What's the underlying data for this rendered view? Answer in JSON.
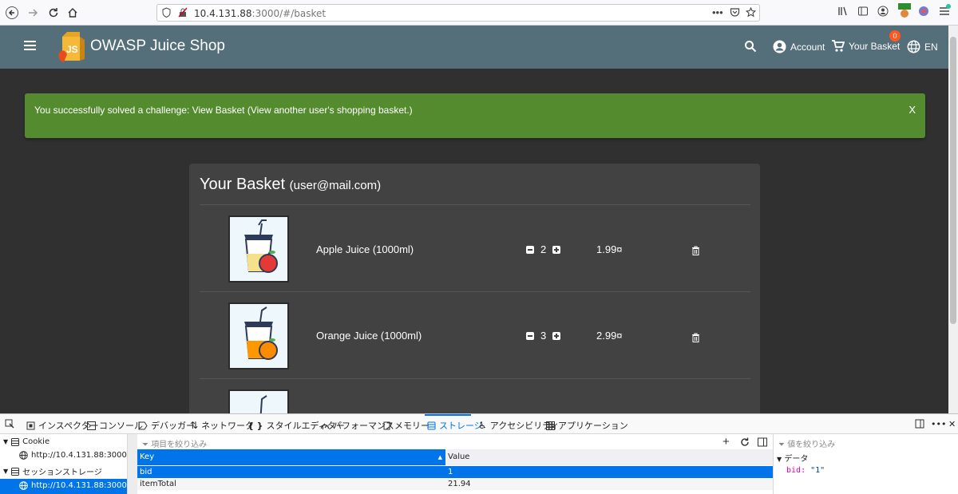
{
  "browser": {
    "url_host": "10.4.131.88",
    "url_path": ":3000/#/basket"
  },
  "app": {
    "title": "OWASP Juice Shop",
    "account_label": "Account",
    "basket_label": "Your Basket",
    "basket_count": "0",
    "language": "EN"
  },
  "notification": {
    "text": "You successfully solved a challenge: View Basket (View another user's shopping basket.)",
    "close_label": "X"
  },
  "basket": {
    "title": "Your Basket",
    "user": "(user@mail.com)",
    "items": [
      {
        "name": "Apple Juice (1000ml)",
        "quantity": "2",
        "price": "1.99¤"
      },
      {
        "name": "Orange Juice (1000ml)",
        "quantity": "3",
        "price": "2.99¤"
      }
    ]
  },
  "devtools": {
    "tabs": [
      "インスペクター",
      "コンソール",
      "デバッガー",
      "ネットワーク",
      "スタイルエディター",
      "パフォーマンス",
      "メモリー",
      "ストレージ",
      "アクセシビリティ",
      "アプリケーション"
    ],
    "active_tab": "ストレージ",
    "tree": {
      "cookie_label": "Cookie",
      "cookie_host": "http://10.4.131.88:3000",
      "session_label": "セッションストレージ",
      "session_host": "http://10.4.131.88:3000"
    },
    "filter_placeholder": "項目を絞り込み",
    "value_filter_placeholder": "値を絞り込み",
    "columns": [
      "Key",
      "Value"
    ],
    "rows": [
      {
        "key": "bid",
        "value": "1"
      },
      {
        "key": "itemTotal",
        "value": "21.94"
      }
    ],
    "data_panel_label": "データ",
    "data_key": "bid",
    "data_value": "\"1\""
  },
  "colors": {
    "header": "#546e7a",
    "snackbar": "#558b2f",
    "card": "#424242",
    "accent": "#0074e8"
  }
}
